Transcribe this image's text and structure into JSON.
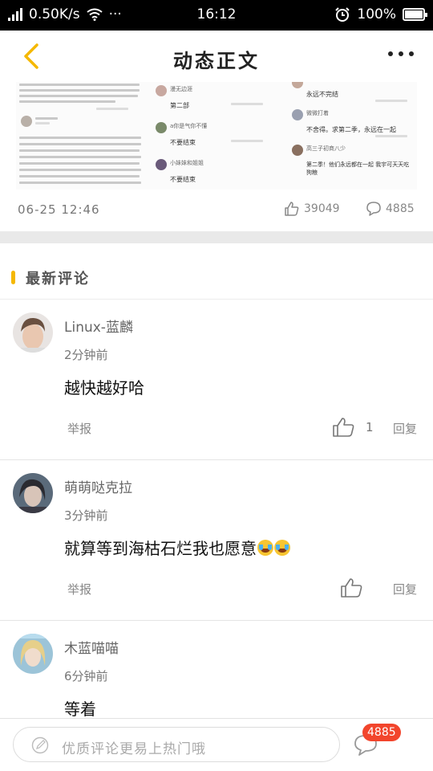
{
  "status_bar": {
    "network_speed": "0.50K/s",
    "time": "16:12",
    "battery": "100%",
    "battery_level": 1.0,
    "dots": "···"
  },
  "nav": {
    "title": "动态正文",
    "back_icon": "chevron-left-icon",
    "more_icon": "more-dots-icon",
    "accent_color": "#F5B800"
  },
  "screenshot_strip": {
    "col2": {
      "name1": "漫无边涯",
      "reply1": "第二部",
      "name2": "a你是气你不懂",
      "reply2": "不要结束",
      "name3": "小妹妹和姐姐",
      "reply3": "不要结束"
    },
    "col3": {
      "reply1": "永远不完结",
      "name2": "微微打着",
      "reply2": "不舍得。求第二季，永远在一起",
      "name3": "高三子初商八少",
      "reply3": "第二季！他们永远都在一起 我宇可天天吃狗粮"
    }
  },
  "meta": {
    "date": "06-25 12:46",
    "likes": "39049",
    "comments": "4885"
  },
  "section": {
    "title": "最新评论"
  },
  "comments": [
    {
      "name": "Linux-蓝麟",
      "time": "2分钟前",
      "text": "越快越好哈",
      "report": "举报",
      "like_count": "1",
      "reply": "回复"
    },
    {
      "name": "萌萌哒克拉",
      "time": "3分钟前",
      "text": "就算等到海枯石烂我也愿意",
      "report": "举报",
      "like_count": "",
      "reply": "回复"
    },
    {
      "name": "木蓝喵喵",
      "time": "6分钟前",
      "text": "等着"
    }
  ],
  "bottom_bar": {
    "placeholder": "优质评论更易上热门哦",
    "badge": "4885"
  }
}
